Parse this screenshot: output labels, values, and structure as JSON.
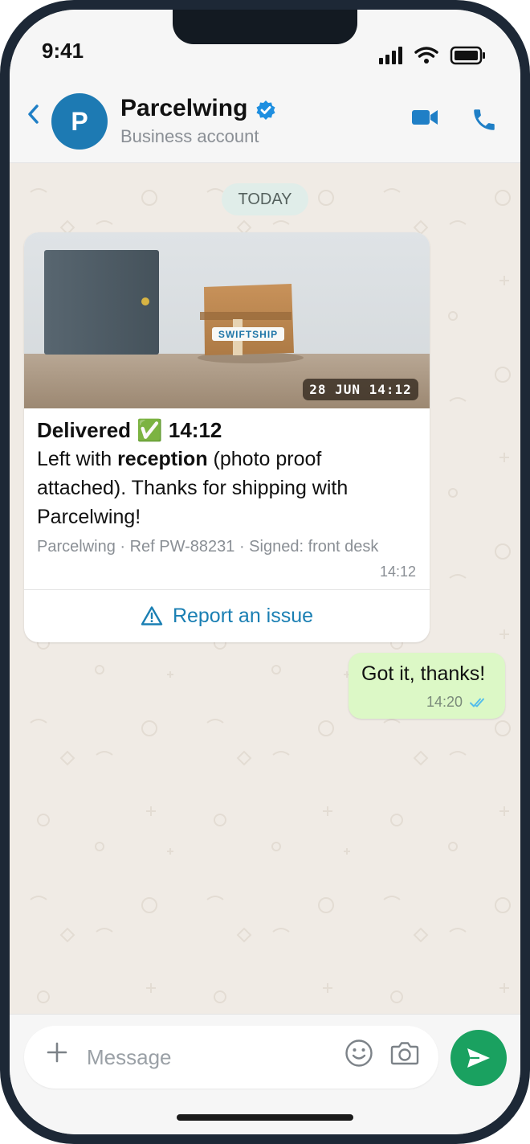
{
  "status": {
    "time": "9:41"
  },
  "header": {
    "back_icon": "chevron-left-icon",
    "avatar_letter": "P",
    "name": "Parcelwing",
    "subtitle": "Business account",
    "accent": "#1f7fc6"
  },
  "chat": {
    "date_label": "TODAY",
    "incoming": {
      "photo_label": "SWIFTSHIP",
      "photo_stamp": "28 JUN 14:12",
      "title": "Delivered ✅ 14:12",
      "body_prefix": "Left with ",
      "body_bold": "reception",
      "body_suffix": " (photo proof attached). Thanks for shipping with Parcelwing!",
      "footer": "Parcelwing · Ref PW-88231 · Signed: front desk",
      "time": "14:12",
      "action_label": "Report an issue"
    },
    "outgoing": {
      "text": "Got it, thanks!",
      "time": "14:20"
    }
  },
  "composer": {
    "placeholder": "Message",
    "send_color": "#1aa160"
  }
}
